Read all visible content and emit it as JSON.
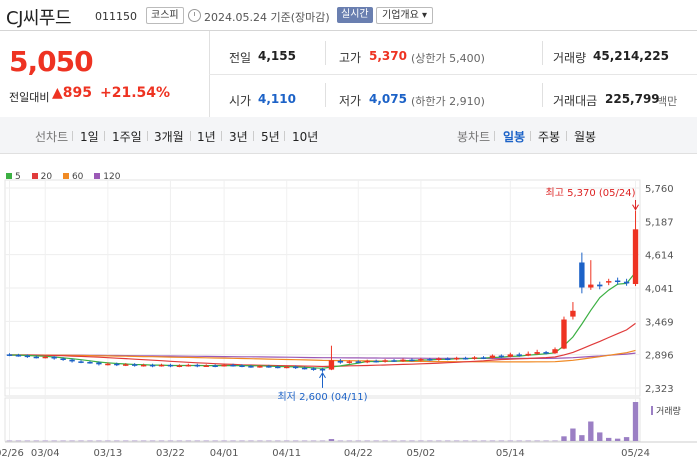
{
  "header": {
    "title": "CJ씨푸드",
    "code": "011150",
    "market": "코스피",
    "date_text": "2024.05.24 기준(장마감)",
    "realtime_label": "실시간",
    "info_label": "기업개요 ▾"
  },
  "quote": {
    "price": "5,050",
    "change_label": "전일대비",
    "change_value": "▲895",
    "change_pct": "+21.54%",
    "prev_close_label": "전일",
    "prev_close": "4,155",
    "high_label": "고가",
    "high": "5,370",
    "upper_limit": "(상한가 5,400)",
    "volume_label": "거래량",
    "volume": "45,214,225",
    "open_label": "시가",
    "open": "4,110",
    "low_label": "저가",
    "low": "4,075",
    "lower_limit": "(하한가 2,910)",
    "turnover_label": "거래대금",
    "turnover": "225,799",
    "turnover_unit": "백만"
  },
  "period_tabs": {
    "label": "선차트",
    "items": [
      "1일",
      "1주일",
      "3개월",
      "1년",
      "3년",
      "5년",
      "10년"
    ]
  },
  "candle_tabs": {
    "label": "봉차트",
    "items": [
      "일봉",
      "주봉",
      "월봉"
    ],
    "selected": "일봉"
  },
  "legend": [
    {
      "label": "5",
      "color": "#3cb043"
    },
    {
      "label": "20",
      "color": "#e03b3b"
    },
    {
      "label": "60",
      "color": "#f08a24"
    },
    {
      "label": "120",
      "color": "#9b59b6"
    }
  ],
  "colors": {
    "up": "#e32",
    "down": "#1c62c7",
    "grid": "#eeeeee",
    "volume": "#9b7fc4"
  },
  "chart_data": {
    "type": "candlestick",
    "y_ticks": [
      "5,760",
      "5,187",
      "4,614",
      "4,041",
      "3,469",
      "2,896",
      "2,323"
    ],
    "ylim": [
      2323,
      5760
    ],
    "x_ticks": [
      "02/26",
      "03/04",
      "03/13",
      "03/22",
      "04/01",
      "04/11",
      "04/22",
      "05/02",
      "05/14",
      "05/24"
    ],
    "high_annotation": "최고 5,370 (05/24)",
    "low_annotation": "최저 2,600 (04/11)",
    "volume_label": "거래량",
    "candles": [
      {
        "o": 2900,
        "c": 2890,
        "h": 2920,
        "l": 2870
      },
      {
        "o": 2890,
        "c": 2880,
        "h": 2910,
        "l": 2860
      },
      {
        "o": 2880,
        "c": 2860,
        "h": 2900,
        "l": 2840
      },
      {
        "o": 2860,
        "c": 2850,
        "h": 2880,
        "l": 2830
      },
      {
        "o": 2850,
        "c": 2860,
        "h": 2880,
        "l": 2830
      },
      {
        "o": 2860,
        "c": 2830,
        "h": 2870,
        "l": 2810
      },
      {
        "o": 2830,
        "c": 2810,
        "h": 2850,
        "l": 2790
      },
      {
        "o": 2810,
        "c": 2780,
        "h": 2830,
        "l": 2760
      },
      {
        "o": 2780,
        "c": 2770,
        "h": 2800,
        "l": 2750
      },
      {
        "o": 2770,
        "c": 2760,
        "h": 2790,
        "l": 2740
      },
      {
        "o": 2760,
        "c": 2730,
        "h": 2780,
        "l": 2710
      },
      {
        "o": 2730,
        "c": 2740,
        "h": 2760,
        "l": 2710
      },
      {
        "o": 2740,
        "c": 2720,
        "h": 2760,
        "l": 2700
      },
      {
        "o": 2720,
        "c": 2730,
        "h": 2750,
        "l": 2700
      },
      {
        "o": 2730,
        "c": 2710,
        "h": 2750,
        "l": 2690
      },
      {
        "o": 2710,
        "c": 2720,
        "h": 2740,
        "l": 2690
      },
      {
        "o": 2720,
        "c": 2700,
        "h": 2740,
        "l": 2680
      },
      {
        "o": 2700,
        "c": 2720,
        "h": 2740,
        "l": 2690
      },
      {
        "o": 2720,
        "c": 2700,
        "h": 2740,
        "l": 2680
      },
      {
        "o": 2700,
        "c": 2710,
        "h": 2730,
        "l": 2680
      },
      {
        "o": 2710,
        "c": 2720,
        "h": 2740,
        "l": 2690
      },
      {
        "o": 2720,
        "c": 2700,
        "h": 2740,
        "l": 2680
      },
      {
        "o": 2700,
        "c": 2710,
        "h": 2730,
        "l": 2690
      },
      {
        "o": 2710,
        "c": 2700,
        "h": 2730,
        "l": 2680
      },
      {
        "o": 2700,
        "c": 2720,
        "h": 2740,
        "l": 2690
      },
      {
        "o": 2720,
        "c": 2710,
        "h": 2740,
        "l": 2690
      },
      {
        "o": 2710,
        "c": 2700,
        "h": 2730,
        "l": 2680
      },
      {
        "o": 2700,
        "c": 2690,
        "h": 2720,
        "l": 2670
      },
      {
        "o": 2690,
        "c": 2700,
        "h": 2720,
        "l": 2670
      },
      {
        "o": 2700,
        "c": 2690,
        "h": 2720,
        "l": 2670
      },
      {
        "o": 2690,
        "c": 2680,
        "h": 2710,
        "l": 2660
      },
      {
        "o": 2680,
        "c": 2690,
        "h": 2710,
        "l": 2660
      },
      {
        "o": 2690,
        "c": 2670,
        "h": 2710,
        "l": 2650
      },
      {
        "o": 2670,
        "c": 2660,
        "h": 2690,
        "l": 2640
      },
      {
        "o": 2660,
        "c": 2650,
        "h": 2680,
        "l": 2620
      },
      {
        "o": 2650,
        "c": 2640,
        "h": 2670,
        "l": 2600
      },
      {
        "o": 2640,
        "c": 2800,
        "h": 3050,
        "l": 2630
      },
      {
        "o": 2790,
        "c": 2760,
        "h": 2820,
        "l": 2740
      },
      {
        "o": 2760,
        "c": 2780,
        "h": 2800,
        "l": 2740
      },
      {
        "o": 2780,
        "c": 2770,
        "h": 2800,
        "l": 2750
      },
      {
        "o": 2770,
        "c": 2790,
        "h": 2810,
        "l": 2750
      },
      {
        "o": 2790,
        "c": 2780,
        "h": 2810,
        "l": 2760
      },
      {
        "o": 2780,
        "c": 2800,
        "h": 2820,
        "l": 2760
      },
      {
        "o": 2800,
        "c": 2790,
        "h": 2820,
        "l": 2770
      },
      {
        "o": 2790,
        "c": 2810,
        "h": 2830,
        "l": 2770
      },
      {
        "o": 2810,
        "c": 2800,
        "h": 2830,
        "l": 2780
      },
      {
        "o": 2800,
        "c": 2820,
        "h": 2840,
        "l": 2780
      },
      {
        "o": 2820,
        "c": 2810,
        "h": 2840,
        "l": 2790
      },
      {
        "o": 2810,
        "c": 2830,
        "h": 2850,
        "l": 2790
      },
      {
        "o": 2830,
        "c": 2820,
        "h": 2850,
        "l": 2800
      },
      {
        "o": 2820,
        "c": 2840,
        "h": 2860,
        "l": 2800
      },
      {
        "o": 2840,
        "c": 2830,
        "h": 2860,
        "l": 2810
      },
      {
        "o": 2830,
        "c": 2850,
        "h": 2870,
        "l": 2810
      },
      {
        "o": 2850,
        "c": 2840,
        "h": 2870,
        "l": 2820
      },
      {
        "o": 2840,
        "c": 2880,
        "h": 2900,
        "l": 2830
      },
      {
        "o": 2880,
        "c": 2860,
        "h": 2900,
        "l": 2840
      },
      {
        "o": 2860,
        "c": 2900,
        "h": 2930,
        "l": 2850
      },
      {
        "o": 2900,
        "c": 2880,
        "h": 2930,
        "l": 2860
      },
      {
        "o": 2880,
        "c": 2910,
        "h": 2950,
        "l": 2870
      },
      {
        "o": 2910,
        "c": 2940,
        "h": 2980,
        "l": 2890
      },
      {
        "o": 2940,
        "c": 2920,
        "h": 2960,
        "l": 2900
      },
      {
        "o": 2920,
        "c": 2990,
        "h": 3020,
        "l": 2910
      },
      {
        "o": 3000,
        "c": 3500,
        "h": 3550,
        "l": 2990
      },
      {
        "o": 3550,
        "c": 3650,
        "h": 3800,
        "l": 3500
      },
      {
        "o": 4480,
        "c": 4050,
        "h": 4650,
        "l": 3950
      },
      {
        "o": 4050,
        "c": 4100,
        "h": 4520,
        "l": 4010
      },
      {
        "o": 4100,
        "c": 4070,
        "h": 4150,
        "l": 4020
      },
      {
        "o": 4140,
        "c": 4160,
        "h": 4200,
        "l": 4090
      },
      {
        "o": 4170,
        "c": 4150,
        "h": 4220,
        "l": 4100
      },
      {
        "o": 4150,
        "c": 4120,
        "h": 4200,
        "l": 4080
      },
      {
        "o": 4110,
        "c": 5050,
        "h": 5370,
        "l": 4075
      }
    ],
    "volume_bars": [
      0.01,
      0.01,
      0.01,
      0.01,
      0.01,
      0.01,
      0.01,
      0.01,
      0.01,
      0.01,
      0.01,
      0.01,
      0.01,
      0.01,
      0.01,
      0.01,
      0.01,
      0.01,
      0.01,
      0.01,
      0.01,
      0.01,
      0.01,
      0.01,
      0.01,
      0.01,
      0.01,
      0.01,
      0.01,
      0.01,
      0.01,
      0.01,
      0.01,
      0.01,
      0.01,
      0.01,
      0.05,
      0.01,
      0.01,
      0.01,
      0.01,
      0.01,
      0.01,
      0.01,
      0.01,
      0.01,
      0.01,
      0.01,
      0.01,
      0.01,
      0.01,
      0.01,
      0.01,
      0.01,
      0.01,
      0.01,
      0.01,
      0.01,
      0.01,
      0.01,
      0.01,
      0.01,
      0.12,
      0.32,
      0.15,
      0.5,
      0.22,
      0.08,
      0.06,
      0.1,
      1.0
    ]
  }
}
